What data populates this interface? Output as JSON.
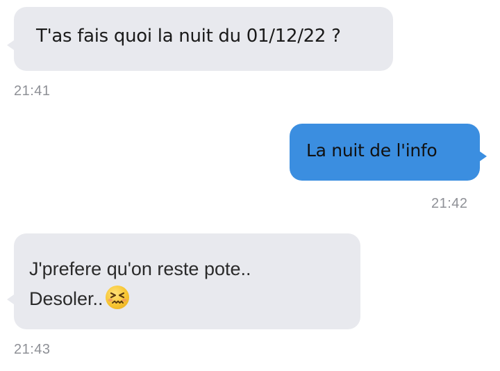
{
  "conversation": {
    "messages": [
      {
        "direction": "incoming",
        "text": "T'as fais quoi la nuit du 01/12/22 ?",
        "time": "21:41"
      },
      {
        "direction": "outgoing",
        "text": "La nuit de l'info",
        "time": "21:42"
      },
      {
        "direction": "incoming",
        "line1": "J'prefere qu'on reste pote..",
        "line2": "Desoler..",
        "emoji": "persevering-face-icon",
        "time": "21:43"
      }
    ]
  },
  "colors": {
    "background": "#ffffff",
    "incoming_bubble": "#e8e9ee",
    "outgoing_bubble": "#3b8ee0",
    "timestamp": "#8e9096"
  }
}
